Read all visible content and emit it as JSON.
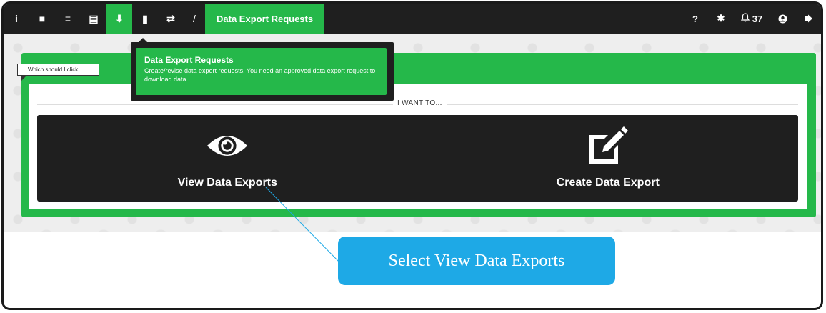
{
  "nav": {
    "left_icons": [
      {
        "name": "info-icon",
        "glyph": "i"
      },
      {
        "name": "dashboard-icon",
        "glyph": "■"
      },
      {
        "name": "database-icon",
        "glyph": "≡"
      },
      {
        "name": "file-icon",
        "glyph": "▤"
      },
      {
        "name": "download-icon",
        "glyph": "⬇"
      },
      {
        "name": "book-icon",
        "glyph": "▮"
      },
      {
        "name": "exchange-icon",
        "glyph": "⇄"
      }
    ],
    "separator": "/",
    "crumb": "Data Export Requests",
    "right": {
      "help_glyph": "?",
      "bug_glyph": "✱",
      "notifications_glyph": "🔔︎",
      "notifications_count": "37",
      "user_glyph": "●",
      "logout_glyph": "➜"
    }
  },
  "tooltip": {
    "title": "Data Export Requests",
    "description": "Create/revise data export requests. You need an approved data export request to download data."
  },
  "which_tag": "Which should I click...",
  "section_label": "I WANT TO...",
  "options": {
    "view": {
      "label": "View Data Exports",
      "icon": "eye-icon"
    },
    "create": {
      "label": "Create Data Export",
      "icon": "edit-icon"
    }
  },
  "callout": "Select View Data Exports",
  "colors": {
    "accent_green": "#25b84a",
    "nav_dark": "#1f1f1f",
    "callout_blue": "#1ea9e6"
  }
}
